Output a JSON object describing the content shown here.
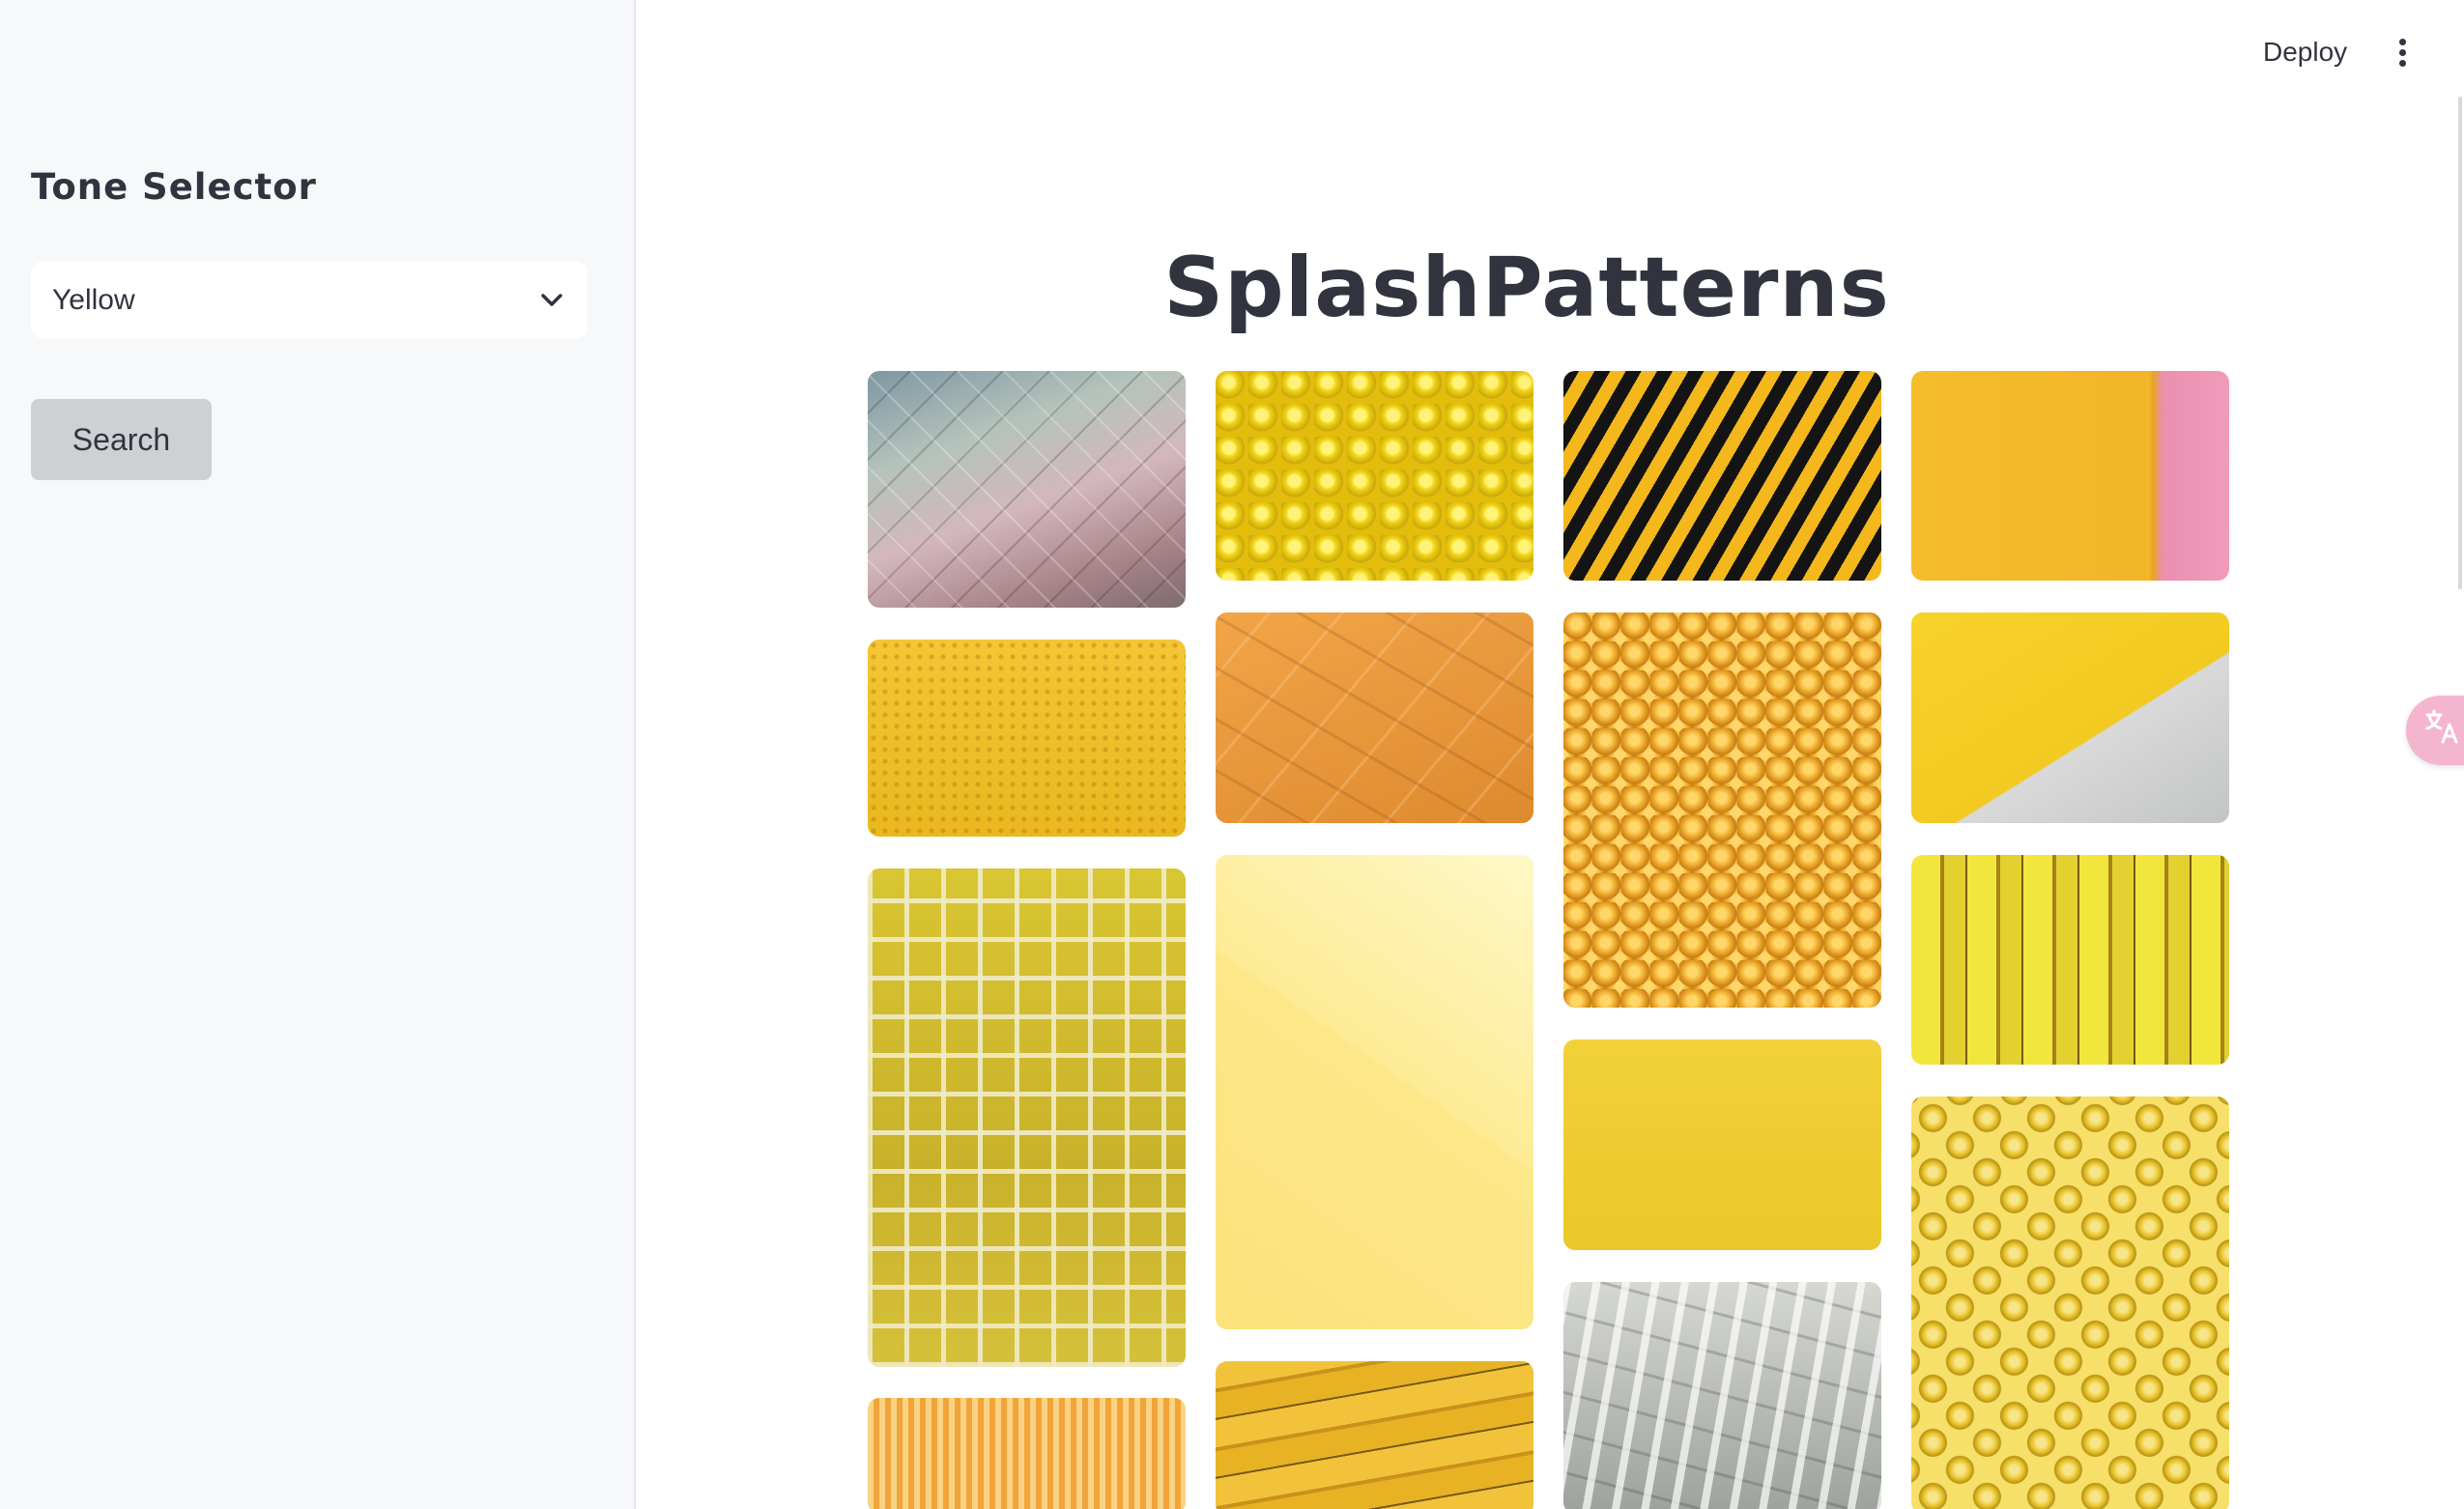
{
  "sidebar": {
    "title": "Tone Selector",
    "select": {
      "value": "Yellow"
    },
    "search_label": "Search"
  },
  "header": {
    "deploy_label": "Deploy"
  },
  "main": {
    "title": "SplashPatterns"
  },
  "gallery": {
    "columns": [
      [
        {
          "name": "scale-tiles-pastel",
          "colors": [
            "#8fa3a8",
            "#c9a7b0"
          ]
        },
        {
          "name": "yellow-dot-texture",
          "colors": [
            "#f2c230",
            "#e9b51e"
          ]
        },
        {
          "name": "yellow-mosaic-tiles",
          "colors": [
            "#d9c430",
            "#b9a326"
          ]
        },
        {
          "name": "orange-stripes",
          "colors": [
            "#f7c165",
            "#f2a43a"
          ]
        }
      ],
      [
        {
          "name": "yellow-balls",
          "colors": [
            "#f7db1e",
            "#e7c20f"
          ]
        },
        {
          "name": "orange-plaster",
          "colors": [
            "#f0a142",
            "#d9812a"
          ]
        },
        {
          "name": "pale-yellow-gradient",
          "colors": [
            "#fff3b0",
            "#fde67f"
          ]
        },
        {
          "name": "bananas",
          "colors": [
            "#e7b324",
            "#9c7a1b"
          ]
        }
      ],
      [
        {
          "name": "black-yellow-chevron",
          "colors": [
            "#f4b81c",
            "#111111"
          ]
        },
        {
          "name": "toy-heads-pile",
          "colors": [
            "#f3b63b",
            "#d98d17"
          ]
        },
        {
          "name": "solid-yellow-card",
          "colors": [
            "#f1cf36",
            "#eac829"
          ]
        },
        {
          "name": "grey-paint-strokes",
          "colors": [
            "#c4c8c2",
            "#8d928d"
          ]
        }
      ],
      [
        {
          "name": "yellow-pink-wall",
          "colors": [
            "#f6bc2c",
            "#ef8fb0"
          ]
        },
        {
          "name": "yellow-concrete-diagonal",
          "colors": [
            "#f6d02a",
            "#c9cbcc"
          ]
        },
        {
          "name": "yellow-corridor",
          "colors": [
            "#efe339",
            "#8d6a15"
          ]
        },
        {
          "name": "yellow-spheres-pattern",
          "colors": [
            "#f7e06a",
            "#d9b71f"
          ]
        }
      ]
    ]
  }
}
